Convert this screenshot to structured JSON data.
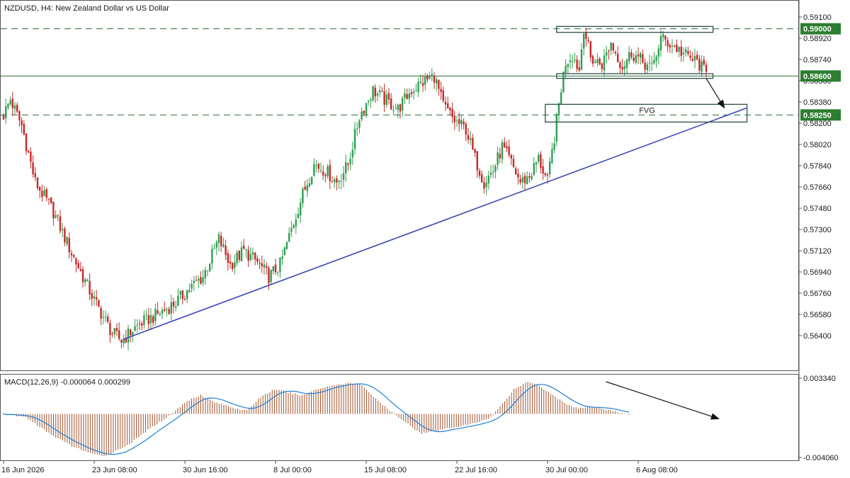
{
  "chart_data": [
    {
      "type": "candlestick",
      "title": "NZDUSD, H4:  New Zealand Dollar vs US Dollar",
      "ylim": [
        0.5628,
        0.5916
      ],
      "y_ticks": [
        "0.59100",
        "0.58920",
        "0.58740",
        "0.58560",
        "0.58380",
        "0.58200",
        "0.58020",
        "0.57840",
        "0.57660",
        "0.57480",
        "0.57300",
        "0.57120",
        "0.56940",
        "0.56760",
        "0.56580",
        "0.56400"
      ],
      "x_ticks": [
        {
          "label": "16 Jun 2026",
          "bar": 0
        },
        {
          "label": "23 Jun 08:00",
          "bar": 40
        },
        {
          "label": "30 Jun 16:00",
          "bar": 80
        },
        {
          "label": "8 Jul 00:00",
          "bar": 120
        },
        {
          "label": "15 Jul 08:00",
          "bar": 160
        },
        {
          "label": "22 Jul 16:00",
          "bar": 200
        },
        {
          "label": "30 Jul 00:00",
          "bar": 240
        },
        {
          "label": "6 Aug 08:00",
          "bar": 280
        }
      ],
      "anchors": [
        [
          0,
          0.5827
        ],
        [
          3,
          0.584
        ],
        [
          8,
          0.5818
        ],
        [
          14,
          0.577
        ],
        [
          22,
          0.5745
        ],
        [
          30,
          0.571
        ],
        [
          40,
          0.567
        ],
        [
          48,
          0.5642
        ],
        [
          52,
          0.5636
        ],
        [
          60,
          0.565
        ],
        [
          68,
          0.5658
        ],
        [
          76,
          0.5668
        ],
        [
          82,
          0.568
        ],
        [
          88,
          0.569
        ],
        [
          95,
          0.5722
        ],
        [
          100,
          0.57
        ],
        [
          106,
          0.5712
        ],
        [
          112,
          0.5702
        ],
        [
          117,
          0.569
        ],
        [
          122,
          0.57
        ],
        [
          127,
          0.573
        ],
        [
          132,
          0.576
        ],
        [
          137,
          0.5785
        ],
        [
          142,
          0.578
        ],
        [
          147,
          0.577
        ],
        [
          152,
          0.5785
        ],
        [
          157,
          0.5826
        ],
        [
          163,
          0.5848
        ],
        [
          168,
          0.584
        ],
        [
          174,
          0.5832
        ],
        [
          180,
          0.5848
        ],
        [
          186,
          0.5856
        ],
        [
          190,
          0.586
        ],
        [
          194,
          0.5835
        ],
        [
          199,
          0.5822
        ],
        [
          204,
          0.5815
        ],
        [
          208,
          0.579
        ],
        [
          212,
          0.577
        ],
        [
          216,
          0.578
        ],
        [
          220,
          0.58
        ],
        [
          224,
          0.5786
        ],
        [
          228,
          0.577
        ],
        [
          232,
          0.5775
        ],
        [
          236,
          0.579
        ],
        [
          240,
          0.577
        ],
        [
          243,
          0.5808
        ],
        [
          246,
          0.585
        ],
        [
          248,
          0.5872
        ],
        [
          251,
          0.5878
        ],
        [
          254,
          0.5865
        ],
        [
          256,
          0.5902
        ],
        [
          259,
          0.5875
        ],
        [
          264,
          0.587
        ],
        [
          268,
          0.5888
        ],
        [
          273,
          0.5868
        ],
        [
          277,
          0.588
        ],
        [
          282,
          0.5872
        ],
        [
          286,
          0.5866
        ],
        [
          290,
          0.5892
        ],
        [
          296,
          0.5885
        ],
        [
          302,
          0.5876
        ],
        [
          306,
          0.5872
        ],
        [
          310,
          0.5862
        ]
      ],
      "levels": [
        {
          "label": "0.59000",
          "value": 0.59,
          "style": "dashed"
        },
        {
          "label": "0.58600",
          "value": 0.586,
          "style": "solid"
        },
        {
          "label": "0.58250",
          "value": 0.5827,
          "style": "dashed"
        }
      ],
      "trendline": {
        "from": {
          "bar": 53,
          "value": 0.5637
        },
        "to": {
          "bar": 328,
          "value": 0.5833
        }
      },
      "zones": [
        {
          "name": "range-top",
          "bar_from": 244,
          "bar_to": 313,
          "value_from": 0.5897,
          "value_to": 0.5902,
          "label": ""
        },
        {
          "name": "range-bottom",
          "bar_from": 244,
          "bar_to": 313,
          "value_from": 0.5858,
          "value_to": 0.5862,
          "label": ""
        },
        {
          "name": "fvg",
          "bar_from": 239,
          "bar_to": 328,
          "value_from": 0.5821,
          "value_to": 0.5836,
          "label": "FVG"
        }
      ],
      "arrow": {
        "from": {
          "bar": 310,
          "value": 0.5858
        },
        "to": {
          "bar": 318,
          "value": 0.5833
        }
      }
    },
    {
      "type": "macd",
      "title": "MACD(12,26,9) -0.000064 0.000299",
      "ylim": [
        -0.00406,
        0.00334
      ],
      "y_ticks": [
        "0.003340",
        "-0.004060"
      ],
      "anchors": [
        [
          0,
          0.0
        ],
        [
          10,
          -0.0003
        ],
        [
          20,
          -0.0018
        ],
        [
          30,
          -0.003
        ],
        [
          40,
          -0.0038
        ],
        [
          45,
          -0.0039
        ],
        [
          55,
          -0.0028
        ],
        [
          65,
          -0.0012
        ],
        [
          72,
          -0.0002
        ],
        [
          80,
          0.0012
        ],
        [
          86,
          0.0018
        ],
        [
          92,
          0.0011
        ],
        [
          100,
          0.0006
        ],
        [
          106,
          0.0003
        ],
        [
          112,
          0.0016
        ],
        [
          118,
          0.0023
        ],
        [
          124,
          0.002
        ],
        [
          130,
          0.0017
        ],
        [
          136,
          0.0023
        ],
        [
          144,
          0.0027
        ],
        [
          150,
          0.0029
        ],
        [
          156,
          0.0027
        ],
        [
          162,
          0.0014
        ],
        [
          168,
          0.0003
        ],
        [
          174,
          -0.0006
        ],
        [
          178,
          -0.0013
        ],
        [
          182,
          -0.0018
        ],
        [
          188,
          -0.0016
        ],
        [
          194,
          -0.0013
        ],
        [
          200,
          -0.0011
        ],
        [
          206,
          -0.0008
        ],
        [
          212,
          -0.0003
        ],
        [
          218,
          0.0012
        ],
        [
          222,
          0.0023
        ],
        [
          228,
          0.003
        ],
        [
          232,
          0.0028
        ],
        [
          238,
          0.0019
        ],
        [
          244,
          0.001
        ],
        [
          250,
          0.0005
        ],
        [
          256,
          0.0007
        ],
        [
          262,
          0.0004
        ],
        [
          268,
          0.0001
        ],
        [
          272,
          -0.0001
        ]
      ],
      "signal_lag": 5,
      "colors": {
        "histogram": "#a0522d",
        "signal": "#1c7fd6"
      },
      "arrow": {
        "from": {
          "bar": 262,
          "value": 0.00301
        },
        "to": {
          "bar": 311,
          "value": -0.00045
        }
      }
    }
  ],
  "colors": {
    "up": "#2e9e4f",
    "down": "#c62828",
    "trendline": "#3c48b0",
    "level": "#2e6b3f",
    "zone": "#2f4f46",
    "tag_bg": "#2e7d32",
    "tag_text": "#ffffff"
  }
}
